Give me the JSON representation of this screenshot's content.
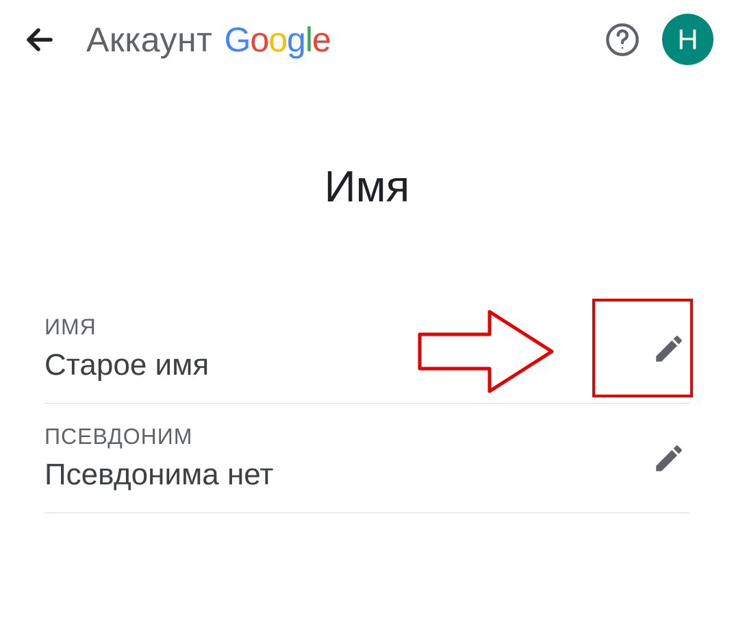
{
  "header": {
    "title_prefix": "Аккаунт",
    "logo_letters": [
      "G",
      "o",
      "o",
      "g",
      "l",
      "e"
    ],
    "avatar_initial": "Н",
    "avatar_color": "#00897B"
  },
  "page": {
    "title": "Имя"
  },
  "rows": {
    "name": {
      "label": "ИМЯ",
      "value": "Старое имя"
    },
    "nickname": {
      "label": "ПСЕВДОНИМ",
      "value": "Псевдонима нет"
    }
  },
  "annotation": {
    "arrow_color": "#e60000",
    "box_color": "#e60000"
  }
}
